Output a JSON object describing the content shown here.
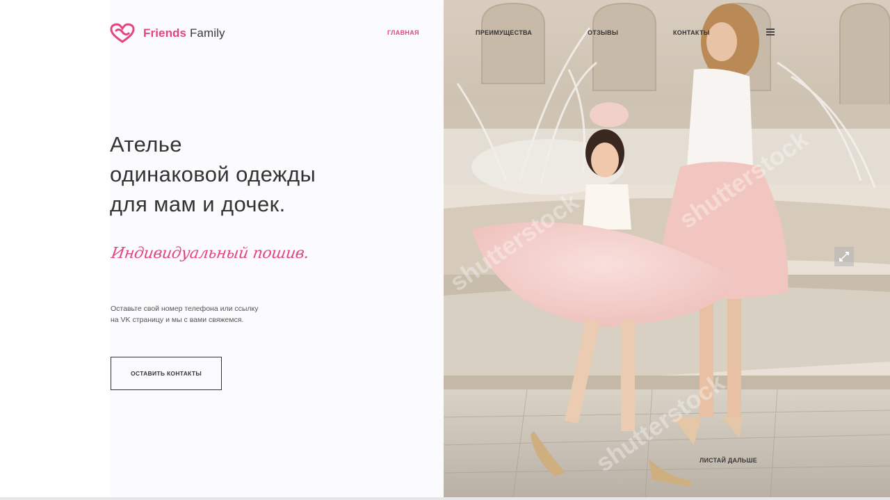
{
  "header": {
    "logo": {
      "brand_first": "Friends",
      "brand_second": "Family",
      "icon": "heart-logo-icon",
      "accent_color": "#e3457d"
    },
    "nav": {
      "items": [
        {
          "label": "ГЛАВНАЯ",
          "active": true
        },
        {
          "label": "ПРЕИМУЩЕСТВА",
          "active": false
        },
        {
          "label": "ОТЗЫВЫ",
          "active": false
        },
        {
          "label": "КОНТАКТЫ",
          "active": false
        }
      ],
      "menu_icon": "hamburger-menu-icon"
    }
  },
  "hero": {
    "headline_lines": [
      "Ателье",
      "одинаковой одежды",
      "для мам и дочек."
    ],
    "script_tagline": "Индивидуальный пошив.",
    "description_lines": [
      "Оставьте свой номер телефона или ссылку",
      "на VK страницу и мы с вами свяжемся."
    ],
    "cta_label": "ОСТАВИТЬ КОНТАКТЫ"
  },
  "photo": {
    "scroll_caption": "ЛИСТАЙ ДАЛЬШЕ",
    "expand_icon": "expand-icon",
    "watermark_icon": "watermark-overlay"
  },
  "colors": {
    "accent": "#e3457d",
    "text_dark": "#333333",
    "background": "#ffffff"
  }
}
